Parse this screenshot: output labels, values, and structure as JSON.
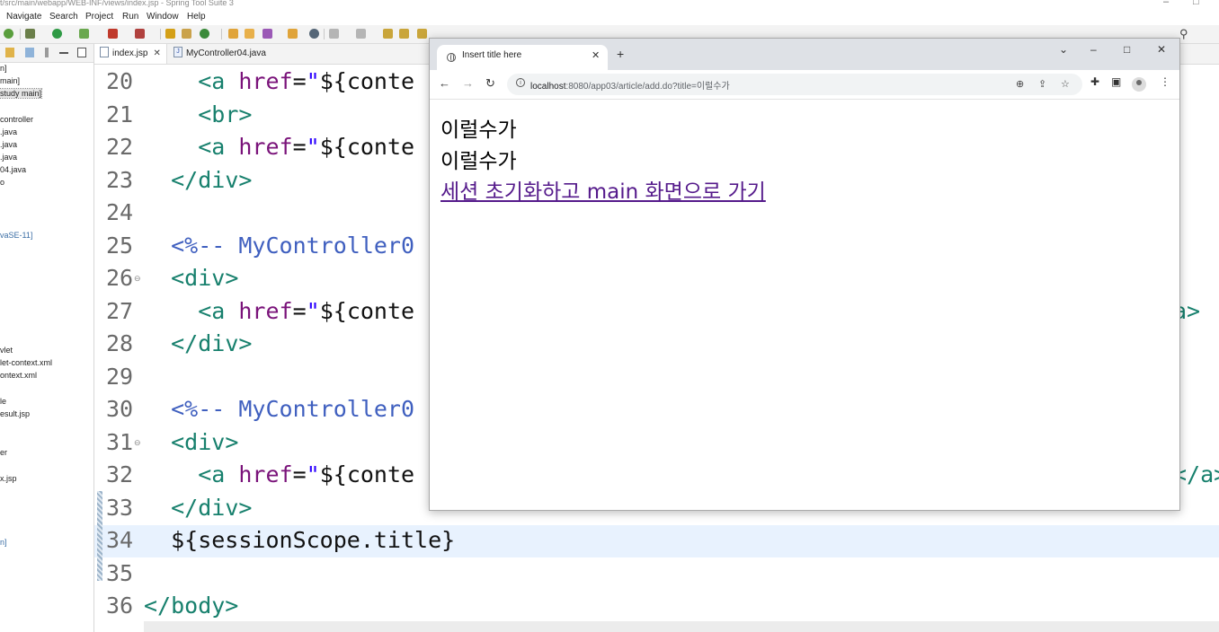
{
  "titlebar": {
    "text": "t/src/main/webapp/WEB-INF/views/index.jsp - Spring Tool Suite 3"
  },
  "menu": [
    "Navigate",
    "Search",
    "Project",
    "Run",
    "Window",
    "Help"
  ],
  "explorer": {
    "items": [
      "n]",
      "main]",
      "study main]",
      "controller",
      ".java",
      ".java",
      ".java",
      "04.java",
      "o",
      "vaSE-11]",
      "vlet",
      "let-context.xml",
      "ontext.xml",
      "le",
      "esult.jsp",
      "er",
      "x.jsp",
      "n]"
    ]
  },
  "editor": {
    "tabs": [
      {
        "label": "index.jsp",
        "close": "✕"
      },
      {
        "label": "MyController04.java"
      }
    ],
    "lines": [
      {
        "num": "20",
        "parts": [
          [
            "el",
            "    "
          ],
          [
            "tag",
            "<a "
          ],
          [
            "attr",
            "href"
          ],
          [
            "el",
            "="
          ],
          [
            "str",
            "\""
          ],
          [
            "el",
            "${conte"
          ]
        ]
      },
      {
        "num": "21",
        "parts": [
          [
            "el",
            "    "
          ],
          [
            "tag",
            "<br>"
          ]
        ]
      },
      {
        "num": "22",
        "parts": [
          [
            "el",
            "    "
          ],
          [
            "tag",
            "<a "
          ],
          [
            "attr",
            "href"
          ],
          [
            "el",
            "="
          ],
          [
            "str",
            "\""
          ],
          [
            "el",
            "${conte"
          ]
        ]
      },
      {
        "num": "23",
        "parts": [
          [
            "el",
            "  "
          ],
          [
            "tag",
            "</div>"
          ]
        ]
      },
      {
        "num": "24",
        "parts": []
      },
      {
        "num": "25",
        "parts": [
          [
            "el",
            "  "
          ],
          [
            "cm",
            "<%-- MyController0"
          ]
        ]
      },
      {
        "num": "26",
        "parts": [
          [
            "el",
            "  "
          ],
          [
            "tag",
            "<div>"
          ]
        ]
      },
      {
        "num": "27",
        "parts": [
          [
            "el",
            "    "
          ],
          [
            "tag",
            "<a "
          ],
          [
            "attr",
            "href"
          ],
          [
            "el",
            "="
          ],
          [
            "str",
            "\""
          ],
          [
            "el",
            "${conte"
          ]
        ]
      },
      {
        "num": "28",
        "parts": [
          [
            "el",
            "  "
          ],
          [
            "tag",
            "</div>"
          ]
        ]
      },
      {
        "num": "29",
        "parts": []
      },
      {
        "num": "30",
        "parts": [
          [
            "el",
            "  "
          ],
          [
            "cm",
            "<%-- MyController0"
          ]
        ]
      },
      {
        "num": "31",
        "parts": [
          [
            "el",
            "  "
          ],
          [
            "tag",
            "<div>"
          ]
        ]
      },
      {
        "num": "32",
        "parts": [
          [
            "el",
            "    "
          ],
          [
            "tag",
            "<a "
          ],
          [
            "attr",
            "href"
          ],
          [
            "el",
            "="
          ],
          [
            "str",
            "\""
          ],
          [
            "el",
            "${conte"
          ]
        ]
      },
      {
        "num": "33",
        "parts": [
          [
            "el",
            "  "
          ],
          [
            "tag",
            "</div>"
          ]
        ]
      },
      {
        "num": "34",
        "parts": [
          [
            "el",
            "  ${sessionScope.title}"
          ]
        ]
      },
      {
        "num": "35",
        "parts": []
      },
      {
        "num": "36",
        "parts": [
          [
            "tag",
            "</body>"
          ]
        ]
      }
    ],
    "overflow_right": [
      {
        "num": "27",
        "text": "a>"
      },
      {
        "num": "32",
        "text": "</a>"
      }
    ]
  },
  "browser": {
    "tab_title": "Insert title here",
    "tab_close": "✕",
    "new_tab": "+",
    "url_host": "localhost",
    "url_path": ":8080/app03/article/add.do?title=이럴수가",
    "content": {
      "line1": "이럴수가",
      "line2": "이럴수가",
      "link": "세션 초기화하고 main 화면으로 가기"
    }
  }
}
